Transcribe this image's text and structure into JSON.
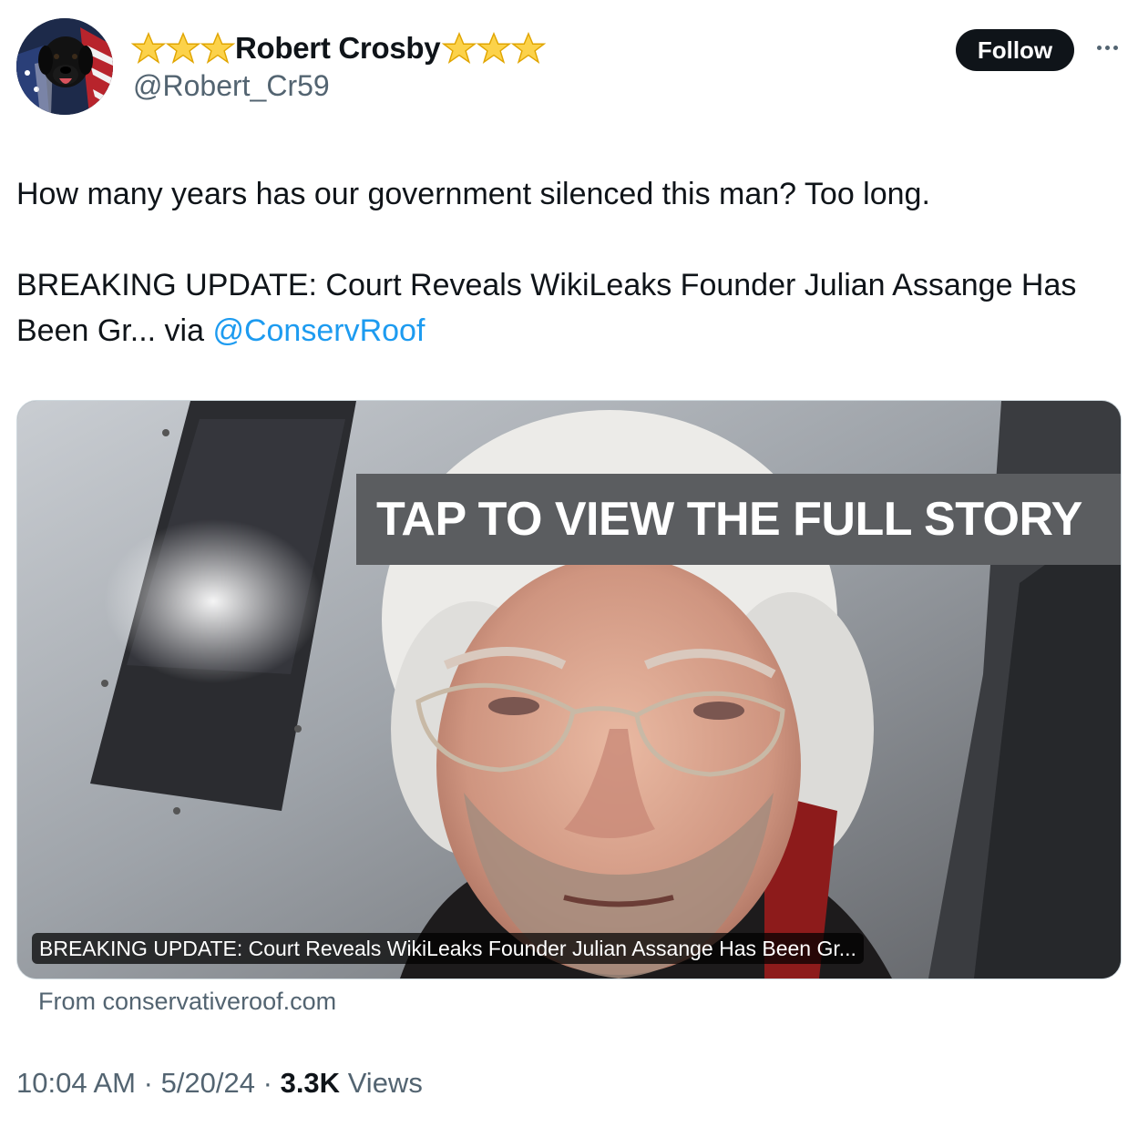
{
  "author": {
    "display_name": "Robert Crosby",
    "handle": "@Robert_Cr59",
    "avatar_icon": "dog-flag-avatar-icon",
    "name_decoration_icon": "star-emoji-icon"
  },
  "actions": {
    "follow_label": "Follow",
    "more_icon": "more-dots-icon"
  },
  "tweet": {
    "line1": "How many years has our government silenced this man? Too long.",
    "line2": "BREAKING UPDATE: Court Reveals WikiLeaks Founder Julian Assange Has Been Gr... via",
    "mention": "@ConservRoof"
  },
  "card": {
    "overlay_text": "TAP TO VIEW THE FULL STORY",
    "caption": "BREAKING UPDATE: Court Reveals WikiLeaks Founder Julian Assange Has Been Gr...",
    "source": "From conservativeroof.com"
  },
  "meta": {
    "time": "10:04 AM",
    "separator": "·",
    "date": "5/20/24",
    "views_count": "3.3K",
    "views_label": "Views"
  },
  "colors": {
    "text": "#0f1419",
    "secondary": "#536471",
    "link": "#1d9bf0",
    "follow_bg": "#0f1419"
  }
}
